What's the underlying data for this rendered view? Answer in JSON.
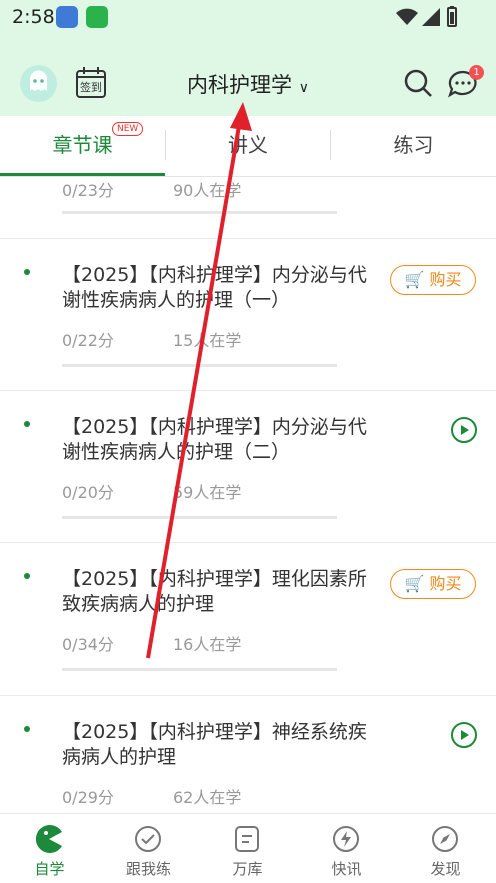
{
  "status_bar": {
    "time": "2:58"
  },
  "header": {
    "title": "内科护理学",
    "checkin_label": "签到",
    "message_count": "1"
  },
  "tabs": [
    {
      "label": "章节课",
      "badge": "NEW"
    },
    {
      "label": "讲义"
    },
    {
      "label": "练习"
    }
  ],
  "top_partial_item": {
    "score": "0/23分",
    "learners": "90人在学"
  },
  "items": [
    {
      "title": "【2025】【内科护理学】内分泌与代谢性疾病病人的护理（一）",
      "score": "0/22分",
      "learners": "15人在学",
      "action": "buy",
      "action_label": "购买"
    },
    {
      "title": "【2025】【内科护理学】内分泌与代谢性疾病病人的护理（二）",
      "score": "0/20分",
      "learners": "59人在学",
      "action": "play"
    },
    {
      "title": "【2025】【内科护理学】理化因素所致疾病病人的护理",
      "score": "0/34分",
      "learners": "16人在学",
      "action": "buy",
      "action_label": "购买"
    },
    {
      "title": "【2025】【内科护理学】神经系统疾病病人的护理",
      "score": "0/29分",
      "learners": "62人在学",
      "action": "play"
    }
  ],
  "bottom_nav": [
    {
      "label": "自学",
      "active": true
    },
    {
      "label": "跟我练"
    },
    {
      "label": "万库"
    },
    {
      "label": "快讯"
    },
    {
      "label": "发现"
    }
  ],
  "colors": {
    "accent": "#1c8a3a",
    "header_bg": "#dff8e6",
    "buy": "#f08a1a",
    "arrow": "#e0202a"
  }
}
